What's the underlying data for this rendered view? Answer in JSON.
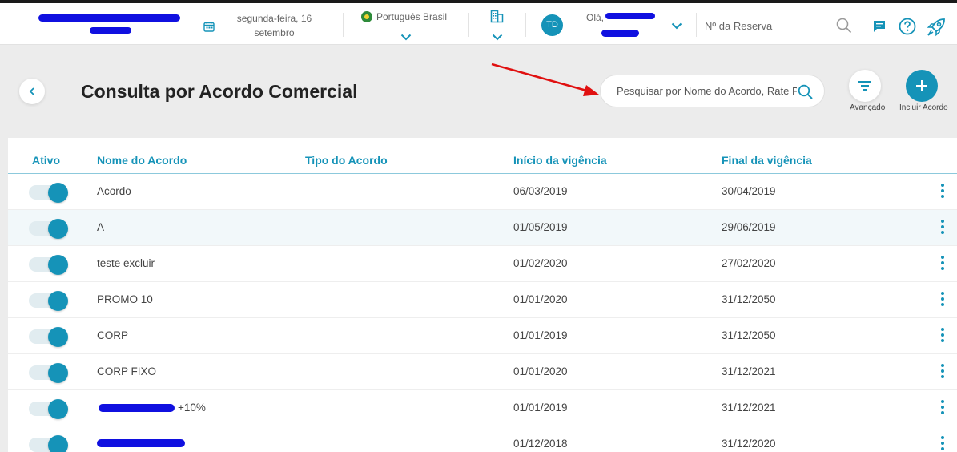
{
  "header": {
    "date_line1": "segunda-feira, 16",
    "date_line2": "setembro",
    "language": "Português Brasil",
    "avatar_initials": "TD",
    "greeting": "Olá,",
    "reservation_placeholder": "Nº da Reserva"
  },
  "page": {
    "title": "Consulta por Acordo Comercial",
    "search_placeholder": "Pesquisar por Nome do Acordo, Rate Plan",
    "advanced_label": "Avançado",
    "add_label": "Incluir Acordo"
  },
  "table": {
    "columns": [
      "Ativo",
      "Nome do Acordo",
      "Tipo do Acordo",
      "Início da vigência",
      "Final da vigência"
    ],
    "rows": [
      {
        "name": "Acordo",
        "type": "",
        "start": "06/03/2019",
        "end": "30/04/2019",
        "active": true
      },
      {
        "name": "A",
        "type": "",
        "start": "01/05/2019",
        "end": "29/06/2019",
        "active": true
      },
      {
        "name": "teste excluir",
        "type": "",
        "start": "01/02/2020",
        "end": "27/02/2020",
        "active": true
      },
      {
        "name": "PROMO 10",
        "type": "",
        "start": "01/01/2020",
        "end": "31/12/2050",
        "active": true
      },
      {
        "name": "CORP",
        "type": "",
        "start": "01/01/2019",
        "end": "31/12/2050",
        "active": true
      },
      {
        "name": "CORP FIXO",
        "type": "",
        "start": "01/01/2020",
        "end": "31/12/2021",
        "active": true
      },
      {
        "name": "+10%",
        "type": "",
        "start": "01/01/2019",
        "end": "31/12/2021",
        "active": true
      },
      {
        "name": "",
        "type": "",
        "start": "01/12/2018",
        "end": "31/12/2020",
        "active": true
      }
    ]
  },
  "colors": {
    "accent": "#1593b8",
    "annotation_arrow": "#e01010",
    "redaction": "#1010e0"
  }
}
